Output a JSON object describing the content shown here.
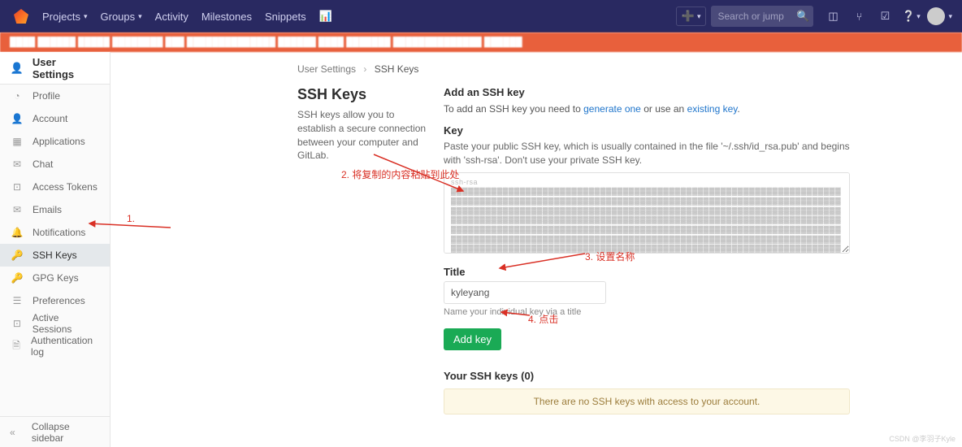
{
  "topnav": {
    "items": [
      "Projects",
      "Groups",
      "Activity",
      "Milestones",
      "Snippets"
    ],
    "search_placeholder": "Search or jump to…"
  },
  "sidebar": {
    "header": "User Settings",
    "items": [
      {
        "icon": "◔",
        "label": "Profile"
      },
      {
        "icon": "👤",
        "label": "Account"
      },
      {
        "icon": "▦",
        "label": "Applications"
      },
      {
        "icon": "✉",
        "label": "Chat"
      },
      {
        "icon": "⊡",
        "label": "Access Tokens"
      },
      {
        "icon": "✉",
        "label": "Emails"
      },
      {
        "icon": "🔔",
        "label": "Notifications"
      },
      {
        "icon": "🔑",
        "label": "SSH Keys",
        "active": true
      },
      {
        "icon": "🔑",
        "label": "GPG Keys"
      },
      {
        "icon": "☰",
        "label": "Preferences"
      },
      {
        "icon": "⊡",
        "label": "Active Sessions"
      },
      {
        "icon": "🗎",
        "label": "Authentication log"
      }
    ],
    "collapse": "Collapse sidebar"
  },
  "breadcrumb": {
    "a": "User Settings",
    "b": "SSH Keys"
  },
  "left": {
    "title": "SSH Keys",
    "desc": "SSH keys allow you to establish a secure connection between your computer and GitLab."
  },
  "right": {
    "add_h": "Add an SSH key",
    "add_p_1": "To add an SSH key you need to ",
    "add_link1": "generate one",
    "add_p_2": " or use an ",
    "add_link2": "existing key",
    "key_label": "Key",
    "key_help": "Paste your public SSH key, which is usually contained in the file '~/.ssh/id_rsa.pub' and begins with 'ssh-rsa'. Don't use your private SSH key.",
    "key_value": "ssh-rsa",
    "title_label": "Title",
    "title_value": "kyleyang",
    "title_hint": "Name your individual key via a title",
    "btn": "Add key",
    "your_keys_h": "Your SSH keys (0)",
    "empty": "There are no SSH keys with access to your account."
  },
  "annotations": {
    "a1": "1.",
    "a2": "2. 将复制的内容粘贴到此处",
    "a3": "3. 设置名称",
    "a4": "4. 点击"
  },
  "watermark": "CSDN @李羽子Kyle"
}
